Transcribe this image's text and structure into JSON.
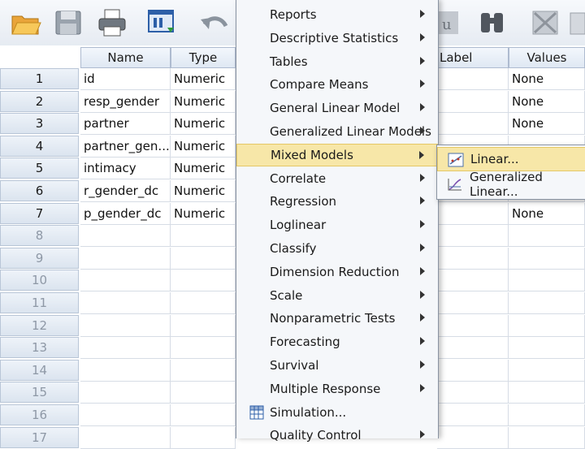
{
  "toolbar": {
    "icons": [
      "open-folder-icon",
      "save-icon",
      "print-icon",
      "dialog-recall-icon",
      "undo-icon",
      "value-labels-icon",
      "find-icon",
      "split-file-icon"
    ]
  },
  "grid": {
    "columns_left": [
      "Name",
      "Type"
    ],
    "columns_right": [
      "Label",
      "Values"
    ],
    "row_numbers": [
      "1",
      "2",
      "3",
      "4",
      "5",
      "6",
      "7",
      "8",
      "9",
      "10",
      "11",
      "12",
      "13",
      "14",
      "15",
      "16",
      "17"
    ],
    "rows": [
      {
        "name": "id",
        "type": "Numeric",
        "values": "None"
      },
      {
        "name": "resp_gender",
        "type": "Numeric",
        "values": "None"
      },
      {
        "name": "partner",
        "type": "Numeric",
        "values": "None"
      },
      {
        "name": "partner_gen...",
        "type": "Numeric",
        "values": ""
      },
      {
        "name": "intimacy",
        "type": "Numeric",
        "values": ""
      },
      {
        "name": "r_gender_dc",
        "type": "Numeric",
        "values": ""
      },
      {
        "name": "p_gender_dc",
        "type": "Numeric",
        "values": "None"
      }
    ]
  },
  "menu": {
    "items": [
      {
        "label": "Reports",
        "sub": true
      },
      {
        "label": "Descriptive Statistics",
        "sub": true
      },
      {
        "label": "Tables",
        "sub": true
      },
      {
        "label": "Compare Means",
        "sub": true
      },
      {
        "label": "General Linear Model",
        "sub": true
      },
      {
        "label": "Generalized Linear Models",
        "sub": true
      },
      {
        "label": "Mixed Models",
        "sub": true
      },
      {
        "label": "Correlate",
        "sub": true
      },
      {
        "label": "Regression",
        "sub": true
      },
      {
        "label": "Loglinear",
        "sub": true
      },
      {
        "label": "Classify",
        "sub": true
      },
      {
        "label": "Dimension Reduction",
        "sub": true
      },
      {
        "label": "Scale",
        "sub": true
      },
      {
        "label": "Nonparametric Tests",
        "sub": true
      },
      {
        "label": "Forecasting",
        "sub": true
      },
      {
        "label": "Survival",
        "sub": true
      },
      {
        "label": "Multiple Response",
        "sub": true
      },
      {
        "label": "Simulation...",
        "sub": false
      },
      {
        "label": "Quality Control",
        "sub": true
      }
    ],
    "highlighted": "Mixed Models"
  },
  "submenu": {
    "items": [
      {
        "label": "Linear..."
      },
      {
        "label": "Generalized Linear..."
      }
    ]
  },
  "colors": {
    "highlight": "#f7e7a8",
    "header": "#dfe8f3"
  }
}
